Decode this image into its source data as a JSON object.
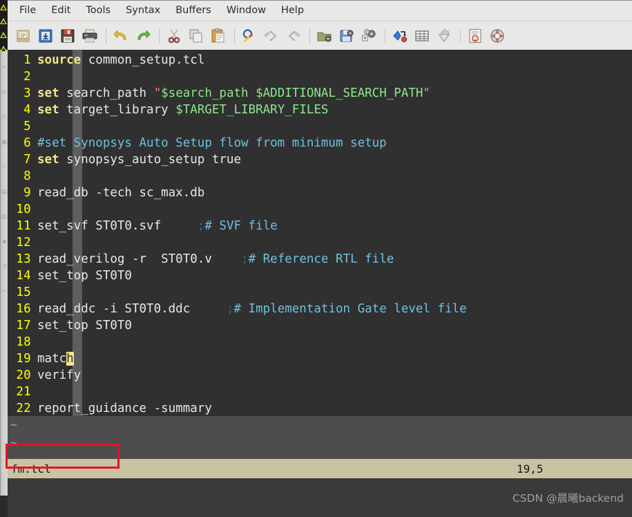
{
  "menubar": {
    "items": [
      {
        "label": "File",
        "name": "menu-file"
      },
      {
        "label": "Edit",
        "name": "menu-edit"
      },
      {
        "label": "Tools",
        "name": "menu-tools"
      },
      {
        "label": "Syntax",
        "name": "menu-syntax"
      },
      {
        "label": "Buffers",
        "name": "menu-buffers"
      },
      {
        "label": "Window",
        "name": "menu-window"
      },
      {
        "label": "Help",
        "name": "menu-help"
      }
    ]
  },
  "toolbar": {
    "buttons": [
      {
        "icon": "new-file-icon"
      },
      {
        "icon": "open-file-icon"
      },
      {
        "icon": "save-icon"
      },
      {
        "icon": "print-icon"
      },
      {
        "icon": "separator"
      },
      {
        "icon": "undo-icon"
      },
      {
        "icon": "redo-icon"
      },
      {
        "icon": "separator"
      },
      {
        "icon": "cut-icon"
      },
      {
        "icon": "copy-icon"
      },
      {
        "icon": "paste-icon"
      },
      {
        "icon": "separator"
      },
      {
        "icon": "find-icon"
      },
      {
        "icon": "find-next-icon"
      },
      {
        "icon": "find-prev-icon"
      },
      {
        "icon": "separator"
      },
      {
        "icon": "load-session-icon"
      },
      {
        "icon": "save-session-icon"
      },
      {
        "icon": "run-script-icon"
      },
      {
        "icon": "separator"
      },
      {
        "icon": "make-icon"
      },
      {
        "icon": "shell-icon"
      },
      {
        "icon": "make-tags-icon"
      },
      {
        "icon": "separator"
      },
      {
        "icon": "help-icon"
      },
      {
        "icon": "find-help-icon"
      }
    ]
  },
  "editor": {
    "lines": [
      {
        "num": "1",
        "segments": [
          {
            "t": "source",
            "c": "kw"
          },
          {
            "t": " common_setup.tcl",
            "c": ""
          }
        ]
      },
      {
        "num": "2",
        "segments": []
      },
      {
        "num": "3",
        "segments": [
          {
            "t": "set",
            "c": "kw"
          },
          {
            "t": " search_path ",
            "c": ""
          },
          {
            "t": "\"",
            "c": "quo"
          },
          {
            "t": "$search_path $ADDITIONAL_SEARCH_PATH",
            "c": "str"
          },
          {
            "t": "\"",
            "c": "quo"
          }
        ]
      },
      {
        "num": "4",
        "segments": [
          {
            "t": "set",
            "c": "kw"
          },
          {
            "t": " target_library ",
            "c": ""
          },
          {
            "t": "$TARGET_LIBRARY_FILES",
            "c": "str"
          }
        ]
      },
      {
        "num": "5",
        "segments": []
      },
      {
        "num": "6",
        "segments": [
          {
            "t": "#set Synopsys Auto Setup flow from minimum setup",
            "c": "cmt"
          }
        ]
      },
      {
        "num": "7",
        "segments": [
          {
            "t": "set",
            "c": "kw"
          },
          {
            "t": " synopsys_auto_setup true",
            "c": ""
          }
        ]
      },
      {
        "num": "8",
        "segments": []
      },
      {
        "num": "9",
        "segments": [
          {
            "t": "read_db -tech sc_max.db",
            "c": ""
          }
        ]
      },
      {
        "num": "10",
        "segments": []
      },
      {
        "num": "11",
        "segments": [
          {
            "t": "set_svf ST0T0.svf     ",
            "c": ""
          },
          {
            "t": ";",
            "c": "semi"
          },
          {
            "t": "# SVF file",
            "c": "cmt"
          }
        ]
      },
      {
        "num": "12",
        "segments": []
      },
      {
        "num": "13",
        "segments": [
          {
            "t": "read_verilog -r  ST0T0.v    ",
            "c": ""
          },
          {
            "t": ";",
            "c": "semi"
          },
          {
            "t": "# Reference RTL file",
            "c": "cmt"
          }
        ]
      },
      {
        "num": "14",
        "segments": [
          {
            "t": "set_top ST0T0",
            "c": ""
          }
        ]
      },
      {
        "num": "15",
        "segments": []
      },
      {
        "num": "16",
        "segments": [
          {
            "t": "read_ddc -i ST0T0.ddc     ",
            "c": ""
          },
          {
            "t": ";",
            "c": "semi"
          },
          {
            "t": "# Implementation Gate level file",
            "c": "cmt"
          }
        ]
      },
      {
        "num": "17",
        "segments": [
          {
            "t": "set_top ST0T0",
            "c": ""
          }
        ]
      },
      {
        "num": "18",
        "segments": []
      },
      {
        "num": "19",
        "segments": [
          {
            "t": "matc",
            "c": ""
          },
          {
            "t": "h",
            "c": "cursor"
          }
        ]
      },
      {
        "num": "20",
        "segments": [
          {
            "t": "verify",
            "c": ""
          }
        ]
      },
      {
        "num": "21",
        "segments": []
      },
      {
        "num": "22",
        "segments": [
          {
            "t": "report_guidance -summary",
            "c": ""
          }
        ]
      }
    ],
    "filler_rows": [
      "~",
      "~"
    ],
    "cursor_char": "h"
  },
  "statusbar": {
    "filename": "fm.tcl",
    "position": "19,5"
  },
  "footer": {
    "watermark": "CSDN @晨曦backend"
  },
  "colors": {
    "editor_bg": "#303030",
    "colorcolumn": "#5e5e5e",
    "linenumber": "#ffff00",
    "keyword": "#f3e58e",
    "string": "#8ce88c",
    "comment": "#6fc0e0",
    "cursor": "#f0e68c",
    "statusbar_bg": "#c9c3a4",
    "annotation": "#e81123",
    "toolbar_bg": "#e8e8e6"
  }
}
